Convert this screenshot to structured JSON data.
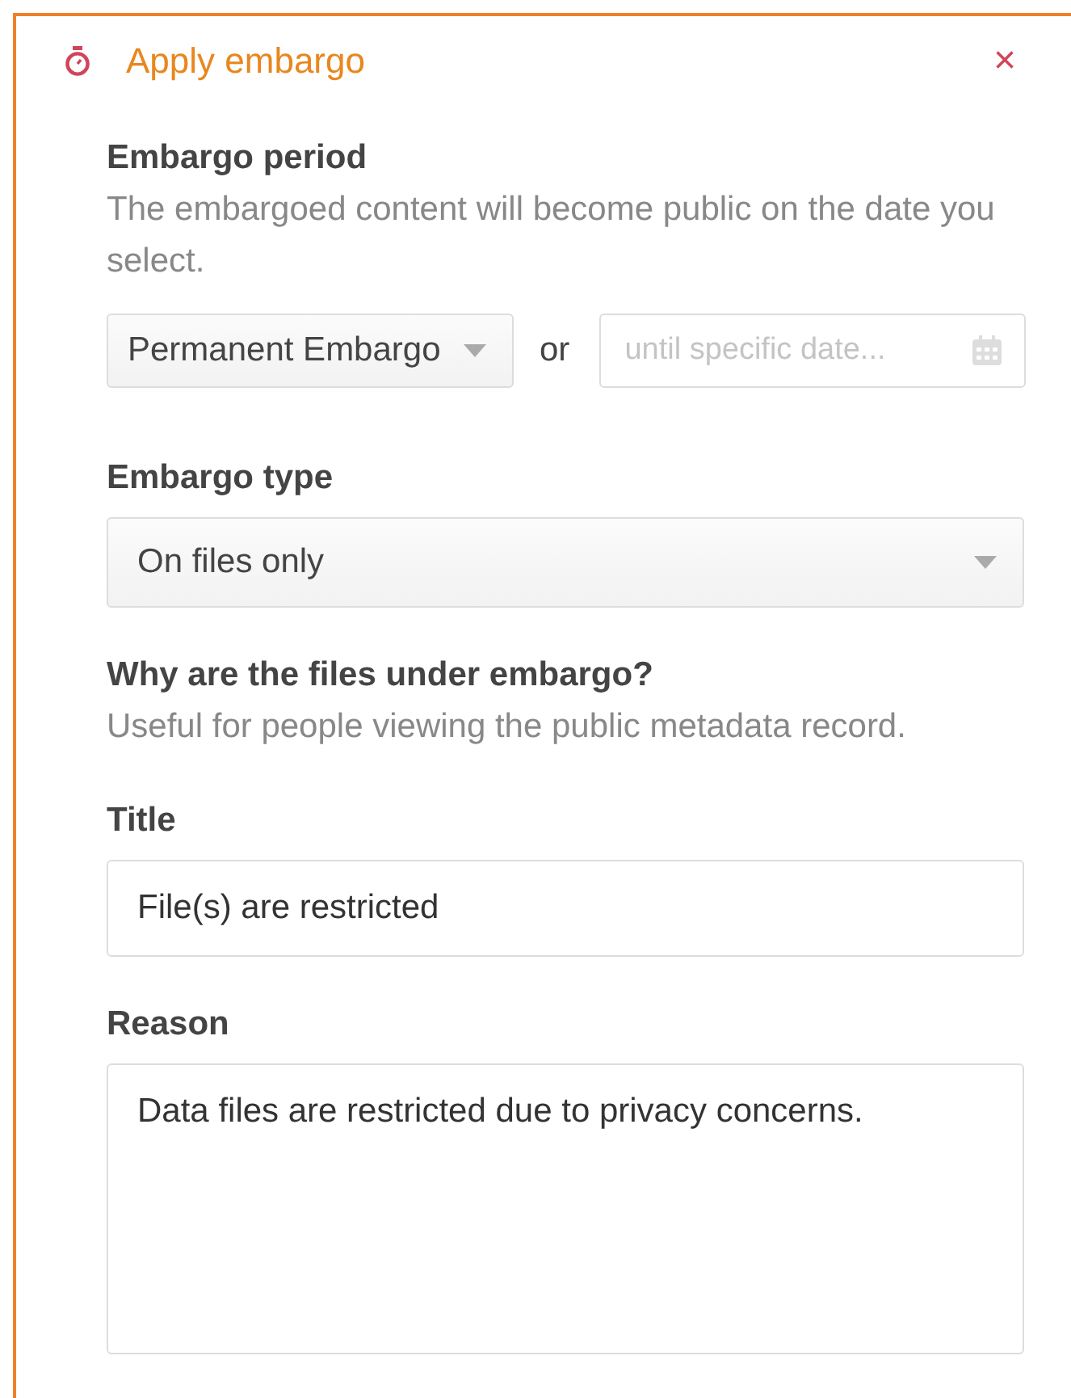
{
  "dialog": {
    "title": "Apply embargo",
    "close": "×"
  },
  "period": {
    "label": "Embargo period",
    "help": "The embargoed content will become public on the date you select.",
    "select": "Permanent Embargo",
    "or": "or",
    "date_placeholder": "until specific date..."
  },
  "type": {
    "label": "Embargo type",
    "select": "On files only"
  },
  "reason_section": {
    "heading": "Why are the files under embargo?",
    "help": "Useful for people viewing the public metadata record.",
    "title_label": "Title",
    "title_value": "File(s) are restricted",
    "reason_label": "Reason",
    "reason_value": "Data files are restricted due to privacy concerns."
  }
}
